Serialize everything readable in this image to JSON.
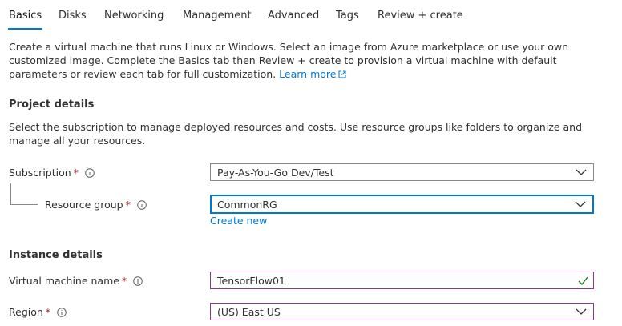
{
  "tabs": [
    {
      "label": "Basics",
      "active": true
    },
    {
      "label": "Disks"
    },
    {
      "label": "Networking"
    },
    {
      "label": "Management"
    },
    {
      "label": "Advanced"
    },
    {
      "label": "Tags"
    },
    {
      "label": "Review + create"
    }
  ],
  "intro": {
    "text": "Create a virtual machine that runs Linux or Windows. Select an image from Azure marketplace or use your own customized image. Complete the Basics tab then Review + create to provision a virtual machine with default parameters or review each tab for full customization.",
    "link": "Learn more"
  },
  "project": {
    "title": "Project details",
    "description": "Select the subscription to manage deployed resources and costs. Use resource groups like folders to organize and manage all your resources.",
    "subscription": {
      "label": "Subscription",
      "required": "*",
      "value": "Pay-As-You-Go Dev/Test"
    },
    "resource_group": {
      "label": "Resource group",
      "required": "*",
      "value": "CommonRG",
      "create_new": "Create new"
    }
  },
  "instance": {
    "title": "Instance details",
    "vm_name": {
      "label": "Virtual machine name",
      "required": "*",
      "value": "TensorFlow01"
    },
    "region": {
      "label": "Region",
      "required": "*",
      "value": "(US) East US"
    }
  },
  "colors": {
    "accent": "#0078d4",
    "required": "#a4262c",
    "valid": "#107c10"
  }
}
